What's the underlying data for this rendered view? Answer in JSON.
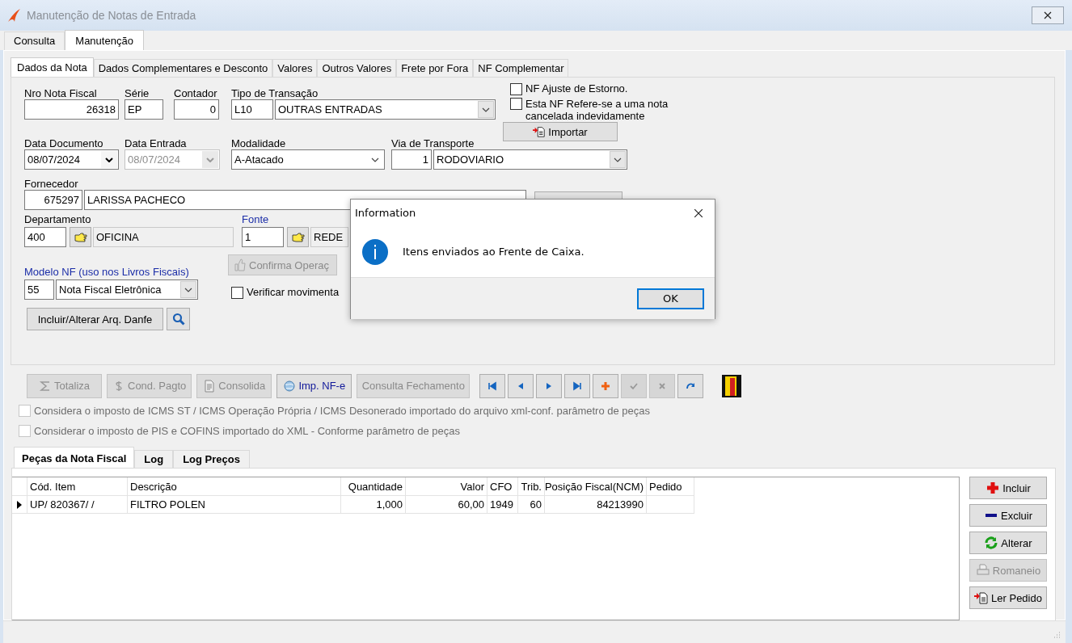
{
  "window": {
    "title": "Manutenção de Notas de Entrada"
  },
  "tabs": [
    {
      "label": "Consulta",
      "selected": false
    },
    {
      "label": "Manutenção",
      "selected": true
    }
  ],
  "subtabs": [
    {
      "label": "Dados da Nota",
      "selected": true
    },
    {
      "label": "Dados Complementares e Desconto",
      "selected": false
    },
    {
      "label": "Valores",
      "selected": false
    },
    {
      "label": "Outros Valores",
      "selected": false
    },
    {
      "label": "Frete por Fora",
      "selected": false
    },
    {
      "label": "NF Complementar",
      "selected": false
    }
  ],
  "form": {
    "nro_nota_fiscal": {
      "label": "Nro Nota Fiscal",
      "value": "26318",
      "highlighted": false
    },
    "serie": {
      "label": "Série",
      "value": "EP",
      "highlighted": false
    },
    "contador": {
      "label": "Contador",
      "value": "0",
      "highlighted": false
    },
    "tipo_transacao": {
      "label": "Tipo de Transação",
      "code": "L10",
      "value": "OUTRAS ENTRADAS",
      "highlighted": false
    },
    "nf_ajuste": {
      "label": "NF Ajuste  de Estorno.",
      "checked": false
    },
    "nf_cancelada": {
      "label": "Esta NF Refere-se a uma nota cancelada indevidamente",
      "checked": false
    },
    "importar_button": "Importar",
    "data_documento": {
      "label": "Data Documento",
      "value": "08/07/2024",
      "disabled": false,
      "highlighted": false
    },
    "data_entrada": {
      "label": "Data Entrada",
      "value": "08/07/2024",
      "disabled": true,
      "highlighted": false
    },
    "modalidade": {
      "label": "Modalidade",
      "value": "A-Atacado",
      "highlighted": false
    },
    "via_transporte": {
      "label": "Via de Transporte",
      "code": "1",
      "value": "RODOVIARIO",
      "highlighted": false
    },
    "fornecedor": {
      "label": "Fornecedor",
      "code": "675297",
      "value": "LARISSA PACHECO",
      "highlighted": false
    },
    "departamento": {
      "label": "Departamento",
      "code": "400",
      "value": "OFICINA",
      "highlighted": false
    },
    "fonte": {
      "label": "Fonte",
      "code": "1",
      "value": "REDE",
      "highlighted": true
    },
    "confirma_button": {
      "label": "Confirma Operaç",
      "disabled": true
    },
    "modelo_nf": {
      "label": "Modelo NF (uso nos Livros Fiscais)",
      "code": "55",
      "value": "Nota Fiscal Eletrônica",
      "highlighted": true
    },
    "verificar": {
      "label": "Verificar movimenta",
      "checked": false
    },
    "danfe_button": "Incluir/Alterar Arq. Danfe"
  },
  "toolbar": [
    {
      "kind": "sum",
      "label": "Totaliza",
      "disabled": true
    },
    {
      "kind": "dollar",
      "label": "Cond. Pagto",
      "disabled": true
    },
    {
      "kind": "doc",
      "label": "Consolida",
      "disabled": true
    },
    {
      "kind": "import",
      "label": "Imp.  NF-e",
      "disabled": false
    },
    {
      "kind": "plain",
      "label": "Consulta Fechamento",
      "disabled": true
    }
  ],
  "navigator": [
    {
      "kind": "first",
      "disabled": false
    },
    {
      "kind": "prior",
      "disabled": false
    },
    {
      "kind": "next",
      "disabled": false
    },
    {
      "kind": "last",
      "disabled": false
    },
    {
      "kind": "insert",
      "disabled": false
    },
    {
      "kind": "post",
      "disabled": true
    },
    {
      "kind": "cancel",
      "disabled": true
    },
    {
      "kind": "refresh",
      "disabled": false
    }
  ],
  "options": [
    {
      "label": "Considera o imposto de ICMS ST / ICMS Operação Própria / ICMS Desonerado importado do arquivo xml-conf. parâmetro de peças",
      "checked": false,
      "disabled": true
    },
    {
      "label": "Considerar o imposto de PIS e COFINS importado do XML - Conforme parâmetro de peças",
      "checked": false,
      "disabled": true
    }
  ],
  "item_tabs": [
    {
      "label": "Peças da Nota Fiscal",
      "selected": true
    },
    {
      "label": "Log",
      "selected": false
    },
    {
      "label": "Log Preços",
      "selected": false
    }
  ],
  "items_table": {
    "columns": [
      "Cód. Item",
      "Descrição",
      "Quantidade",
      "Valor",
      "CFO",
      "Trib.",
      "Posição Fiscal(NCM)",
      "Pedido"
    ],
    "rows": [
      {
        "current": true,
        "cells": [
          "UP/  820367/  /",
          "FILTRO POLEN",
          "1,000",
          "60,00",
          "1949",
          "60",
          "84213990",
          ""
        ]
      }
    ]
  },
  "item_buttons": [
    {
      "kind": "add",
      "label": "Incluir",
      "disabled": false
    },
    {
      "kind": "remove",
      "label": "Excluir",
      "disabled": false
    },
    {
      "kind": "edit",
      "label": "Alterar",
      "disabled": false
    },
    {
      "kind": "print",
      "label": "Romaneio",
      "disabled": true
    },
    {
      "kind": "read",
      "label": "Ler Pedido",
      "disabled": false
    }
  ],
  "dialog": {
    "title": "Information",
    "message": "Itens enviados ao Frente de Caixa.",
    "ok_button": "OK"
  }
}
